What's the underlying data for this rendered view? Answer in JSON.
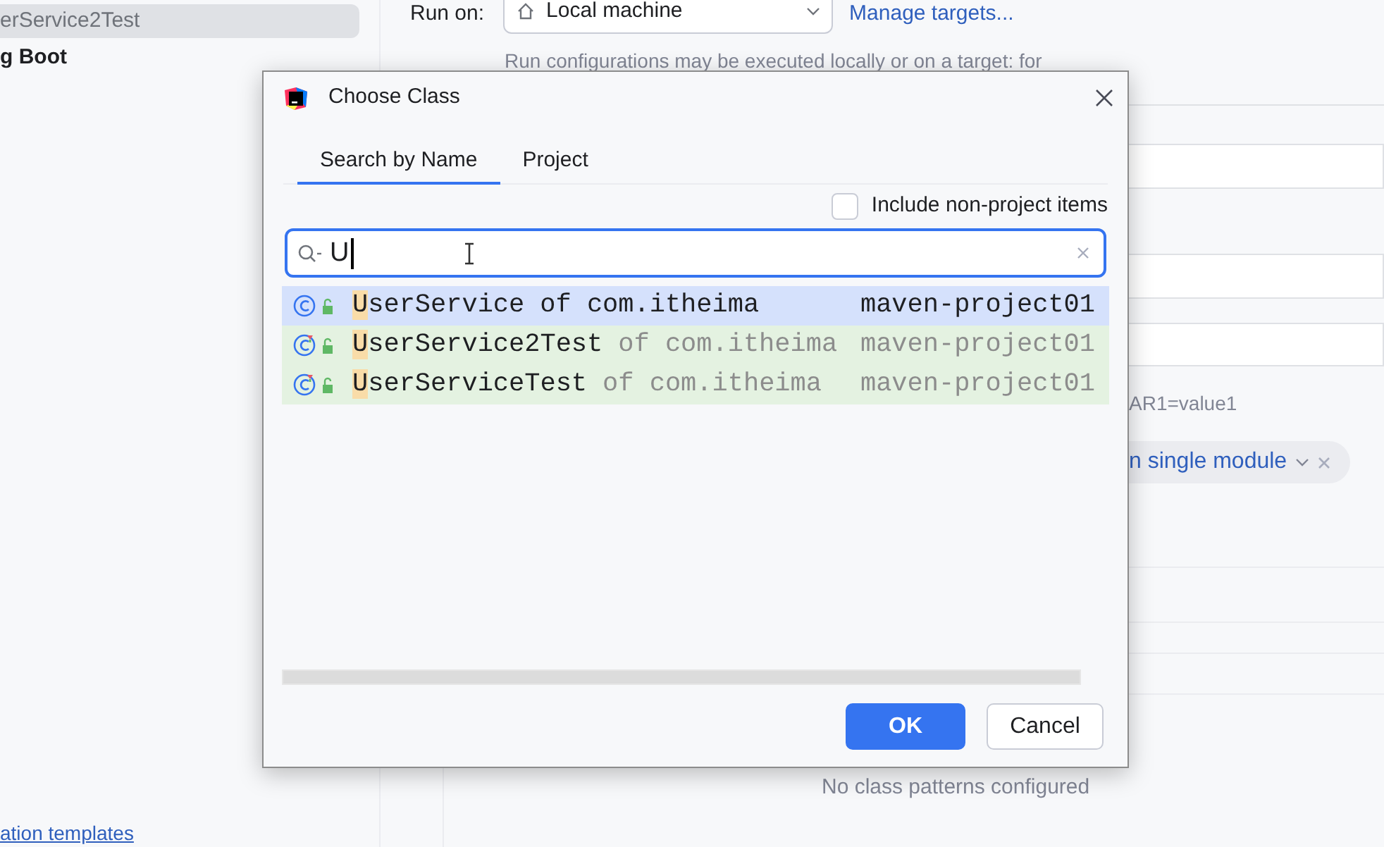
{
  "sidebar": {
    "items": [
      {
        "label": "erService2Test",
        "kind": "config",
        "selected": true
      },
      {
        "label": "g Boot",
        "kind": "group",
        "selected": false
      }
    ],
    "link": "ation templates"
  },
  "run_on": {
    "label": "Run on:",
    "target": "Local machine",
    "link": "Manage targets..."
  },
  "hint": "Run configurations may be executed locally or on a target: for",
  "env_text": "AR1=value1",
  "chip": {
    "label": "n single module"
  },
  "footer_text": "No class patterns configured",
  "dialog": {
    "title": "Choose Class",
    "tabs": [
      {
        "label": "Search by Name",
        "selected": true
      },
      {
        "label": "Project",
        "selected": false
      }
    ],
    "include_checkbox": {
      "label": "Include non-project items",
      "checked": false
    },
    "search": {
      "value": "U"
    },
    "results": [
      {
        "kind": "class",
        "match": "U",
        "name": "serService",
        "package": "of com.itheima",
        "module": "maven-project01",
        "selected": true
      },
      {
        "kind": "test",
        "match": "U",
        "name": "serService2Test",
        "package": "of com.itheima",
        "module": "maven-project01",
        "selected": false
      },
      {
        "kind": "test",
        "match": "U",
        "name": "serServiceTest",
        "package": "of com.itheima",
        "module": "maven-project01",
        "selected": false
      }
    ],
    "buttons": [
      {
        "label": "OK",
        "kind": "primary"
      },
      {
        "label": "Cancel",
        "kind": "secondary"
      }
    ]
  }
}
